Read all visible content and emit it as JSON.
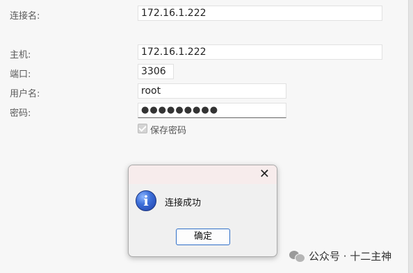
{
  "form": {
    "connection_name": {
      "label": "连接名:",
      "value": "172.16.1.222"
    },
    "host": {
      "label": "主机:",
      "value": "172.16.1.222"
    },
    "port": {
      "label": "端口:",
      "value": "3306"
    },
    "username": {
      "label": "用户名:",
      "value": "root"
    },
    "password": {
      "label": "密码:",
      "value": "●●●●●●●●●"
    },
    "save_password": {
      "label": "保存密码",
      "checked": true
    }
  },
  "dialog": {
    "close_symbol": "✕",
    "icon": "info-icon",
    "icon_glyph": "i",
    "message": "连接成功",
    "ok_label": "确定"
  },
  "watermark": {
    "text": "公众号 · 十二主神",
    "icon": "wechat-icon"
  }
}
